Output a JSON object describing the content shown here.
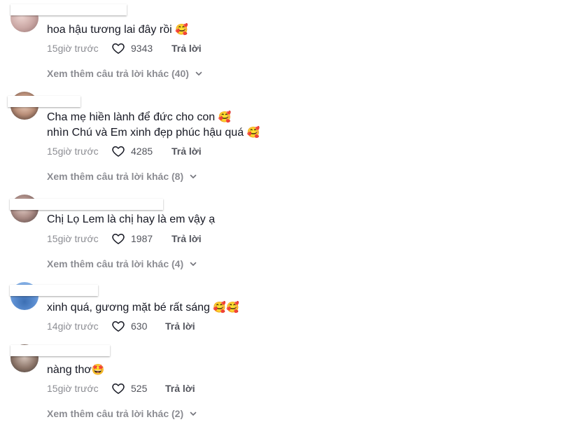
{
  "comments": [
    {
      "text_lines": [
        "hoa hậu tương lai đây rồi"
      ],
      "line_emojis": [
        "🥰"
      ],
      "time": "15giờ trước",
      "likes": "9343",
      "reply_label": "Trả lời",
      "more_replies": "Xem thêm câu trả lời khác (40)"
    },
    {
      "text_lines": [
        "Cha mẹ hiền lành để đức cho con",
        "nhìn Chú và Em xinh đẹp phúc hậu quá"
      ],
      "line_emojis": [
        "🥰",
        "🥰"
      ],
      "time": "15giờ trước",
      "likes": "4285",
      "reply_label": "Trả lời",
      "more_replies": "Xem thêm câu trả lời khác (8)"
    },
    {
      "text_lines": [
        "Chị Lọ Lem là chị hay là em vậy ạ"
      ],
      "line_emojis": [
        ""
      ],
      "time": "15giờ trước",
      "likes": "1987",
      "reply_label": "Trả lời",
      "more_replies": "Xem thêm câu trả lời khác (4)"
    },
    {
      "text_lines": [
        "xinh quá, gương mặt bé rất sáng"
      ],
      "line_emojis": [
        "🥰🥰"
      ],
      "time": "14giờ trước",
      "likes": "630",
      "reply_label": "Trả lời"
    },
    {
      "text_lines": [
        "nàng thơ"
      ],
      "line_emojis": [
        "🤩"
      ],
      "time": "15giờ trước",
      "likes": "525",
      "reply_label": "Trả lời",
      "more_replies": "Xem thêm câu trả lời khác (2)"
    }
  ],
  "icons": {
    "like": "heart-outline-icon",
    "expand": "chevron-down-icon"
  },
  "colors": {
    "text": "#161823",
    "secondary": "#8a8b91",
    "background": "#ffffff"
  }
}
